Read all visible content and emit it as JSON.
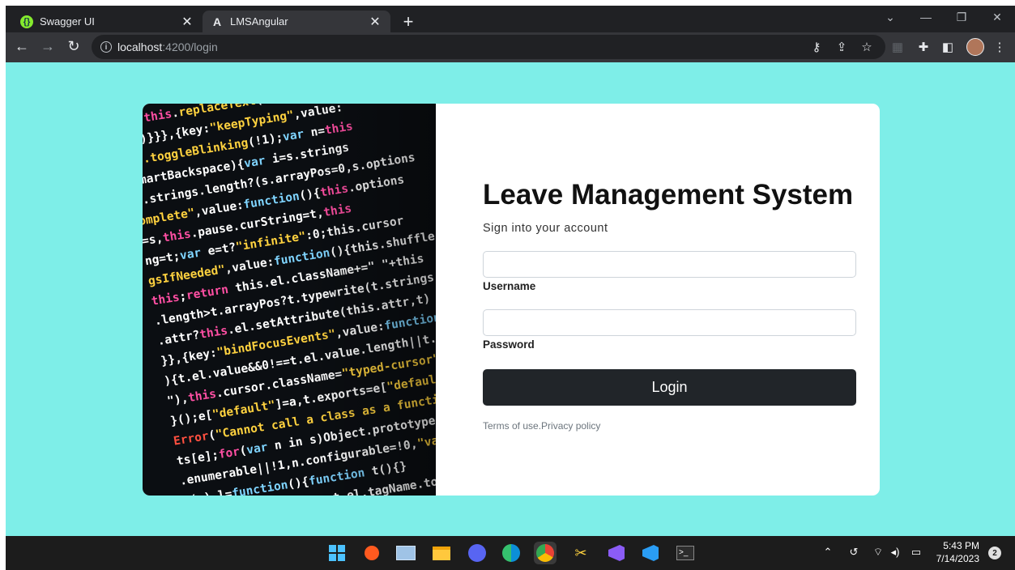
{
  "browser": {
    "tabs": [
      {
        "title": "Swagger UI",
        "icon": "swagger-icon"
      },
      {
        "title": "LMSAngular",
        "icon": "angular-icon",
        "active": true
      }
    ],
    "new_tab_label": "+",
    "url_host": "localhost",
    "url_path": ":4200/login"
  },
  "login": {
    "title": "Leave Management System",
    "subtitle": "Sign into your account",
    "username_label": "Username",
    "password_label": "Password",
    "login_button": "Login",
    "terms_link": "Terms of use.",
    "privacy_link": "Privacy policy"
  },
  "taskbar": {
    "time": "5:43 PM",
    "date": "7/14/2023",
    "notifications": "2"
  },
  "colors": {
    "page_background": "#7eeee8",
    "button": "#212529"
  }
}
